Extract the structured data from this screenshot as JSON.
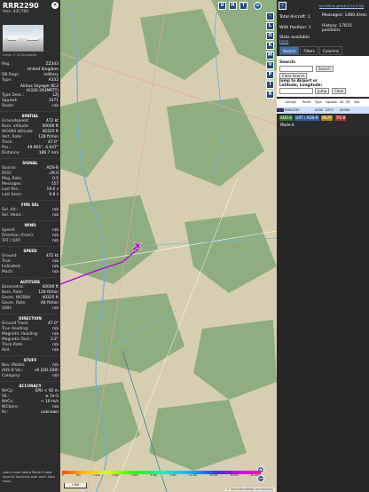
{
  "aircraft": {
    "callsign": "RRR2290",
    "hex_line": "Hex: 43C780",
    "photo_credit": "Image © Liz Klingbeiler",
    "summary": [
      {
        "label": "Reg.:",
        "value": "ZZ343"
      },
      {
        "label": "",
        "value": "United Kingdom"
      },
      {
        "label": "DB flags:",
        "value": "military"
      },
      {
        "label": "Type:",
        "value": "A332"
      },
      {
        "label": "",
        "value": "Airbus Voyager KC2 (A330-243MRTT)",
        "two": true
      },
      {
        "label": "Type Desc.:",
        "value": "L2J"
      },
      {
        "label": "Squawk:",
        "value": "3371"
      },
      {
        "label": "Route:",
        "value": "n/a"
      }
    ],
    "sections": [
      {
        "title": "SPATIAL",
        "rows": [
          {
            "label": "Groundspeed:",
            "value": "472 kt"
          },
          {
            "label": "Baro. altitude:",
            "value": "40000 ft"
          },
          {
            "label": "WGS84 altitude:",
            "value": "40325 ft"
          },
          {
            "label": "Vert. Rate:",
            "value": "128 ft/min"
          },
          {
            "label": "Track:",
            "value": "47.0°"
          },
          {
            "label": "Pos.:",
            "value": "49.901°, 6.647°"
          },
          {
            "label": "Distance:",
            "value": "186.7 nmi"
          }
        ]
      },
      {
        "title": "SIGNAL",
        "rows": [
          {
            "label": "Source:",
            "value": "ADS-B"
          },
          {
            "label": "RSSI:",
            "value": "-29.0"
          },
          {
            "label": "Msg. Rate:",
            "value": "0.5"
          },
          {
            "label": "Messages:",
            "value": "157"
          },
          {
            "label": "Last Pos.:",
            "value": "19.6 s"
          },
          {
            "label": "Last Seen:",
            "value": "0.8 s"
          }
        ]
      },
      {
        "title": "FMS SEL",
        "rows": [
          {
            "label": "Sel. Alt.:",
            "value": "n/a"
          },
          {
            "label": "Sel. Head.:",
            "value": "n/a"
          }
        ]
      },
      {
        "title": "WIND",
        "rows": [
          {
            "label": "Speed:",
            "value": "n/a"
          },
          {
            "label": "Direction (from):",
            "value": "n/a"
          },
          {
            "label": "TAT / OAT:",
            "value": "n/a"
          }
        ]
      },
      {
        "title": "SPEED",
        "rows": [
          {
            "label": "Ground:",
            "value": "472 kt"
          },
          {
            "label": "True:",
            "value": "n/a"
          },
          {
            "label": "Indicated:",
            "value": "n/a"
          },
          {
            "label": "Mach:",
            "value": "n/a"
          }
        ]
      },
      {
        "title": "ALTITUDE",
        "rows": [
          {
            "label": "Barometric:",
            "value": "40000 ft"
          },
          {
            "label": "Baro. Rate:",
            "value": "128 ft/min"
          },
          {
            "label": "Geom. WGS84:",
            "value": "40325 ft"
          },
          {
            "label": "Geom. Rate:",
            "value": "64 ft/min"
          },
          {
            "label": "QNH:",
            "value": "n/a"
          }
        ]
      },
      {
        "title": "DIRECTION",
        "rows": [
          {
            "label": "Ground Track:",
            "value": "47.0°"
          },
          {
            "label": "True Heading:",
            "value": "n/a"
          },
          {
            "label": "Magnetic Heading:",
            "value": "n/a"
          },
          {
            "label": "Magnetic Decl.:",
            "value": "3.2°"
          },
          {
            "label": "Track Rate:",
            "value": "n/a"
          },
          {
            "label": "Roll:",
            "value": "n/a"
          }
        ]
      },
      {
        "title": "STUFF",
        "rows": [
          {
            "label": "Nav. Modes:",
            "value": "n/a"
          },
          {
            "label": "ADS-B Ver.:",
            "value": "v0 (DO-260)"
          },
          {
            "label": "Category:",
            "value": "n/a"
          }
        ]
      },
      {
        "title": "ACCURACY",
        "rows": [
          {
            "label": "NACp:",
            "value": "EPU < 92 m"
          },
          {
            "label": "SIL:",
            "value": "≤ 1e-5"
          },
          {
            "label": "NACv:",
            "value": "< 10 m/s"
          },
          {
            "label": "NICbaro:",
            "value": "n/a"
          },
          {
            "label": "Rc:",
            "value": "unknown"
          }
        ]
      }
    ],
    "more_info": "Learn more about Mode S data type by hovering over each data label."
  },
  "map": {
    "top_buttons": [
      "U",
      "H",
      "T"
    ],
    "side_buttons": [
      "L",
      "O",
      "K",
      "M",
      "V",
      "P",
      "I",
      "R"
    ],
    "legend_ticks": [
      "0",
      "500",
      "1 000",
      "2 000",
      "4 000",
      "6 000",
      "8 000",
      "10 000",
      "20 000",
      "30 000",
      "40 000+"
    ],
    "scale_label": "2 NM",
    "attribution": "© OpenStreetMap contributors.",
    "zoom_in": "+",
    "zoom_out": "−",
    "colors": {
      "forest": "#8fae7f",
      "field": "#d7ceb2",
      "track": "#b400e6",
      "river": "#6fa8d6",
      "aircraft": "#c400d0"
    }
  },
  "panel": {
    "github_link": "tar1090 on github (3.14.1733)",
    "total_aircraft": "Total Aircraft: 1",
    "with_position": "With Position: 1",
    "stats_available": "Stats available",
    "here": "here",
    "messages": "Messages: 1460.4/sec",
    "history": "History: 17815 positions",
    "tabs": [
      "Search",
      "Filters",
      "Columns"
    ],
    "search_label": "Search:",
    "search_button": "Search",
    "clear_search": "Clear Search",
    "jump_label": "Jump to Airport or Latitude, Longitude:",
    "jump_button": "Jump",
    "clear_button": "Clear",
    "table_headers": [
      "",
      "Callsign",
      "Route",
      "Type",
      "Squawk",
      "Alt. (ft)",
      "Spd"
    ],
    "table_rows": [
      [
        "",
        "RRR2290",
        "",
        "A332",
        "3371",
        "40000",
        ""
      ]
    ],
    "source_chips": [
      "ADS-B",
      "UAT / ADS-R",
      "MLAT",
      "TIS-B"
    ],
    "mode_s": "Mode-S"
  }
}
